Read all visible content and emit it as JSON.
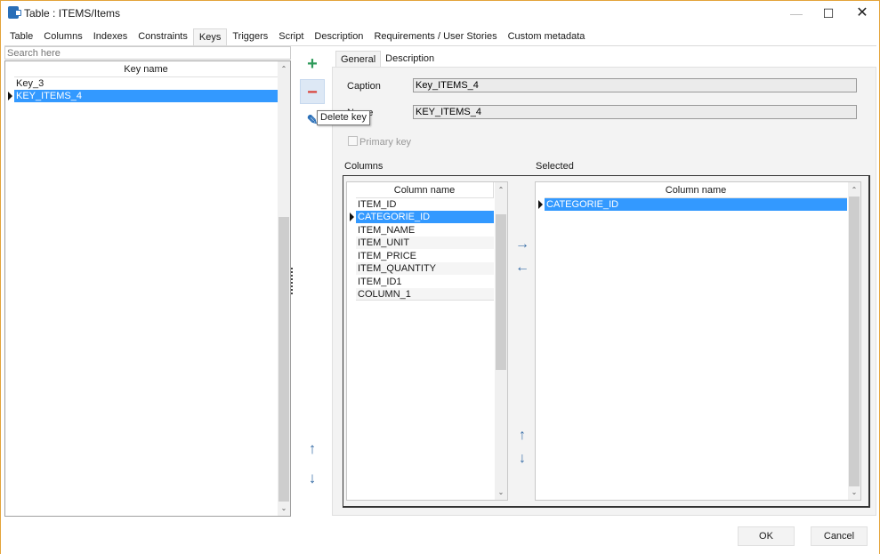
{
  "window": {
    "title": "Table : ITEMS/Items",
    "controls": {
      "minimize": "—",
      "maximize": "☐",
      "close": "✕"
    }
  },
  "tabs": [
    {
      "label": "Table",
      "active": false
    },
    {
      "label": "Columns",
      "active": false
    },
    {
      "label": "Indexes",
      "active": false
    },
    {
      "label": "Constraints",
      "active": false
    },
    {
      "label": "Keys",
      "active": true
    },
    {
      "label": "Triggers",
      "active": false
    },
    {
      "label": "Script",
      "active": false
    },
    {
      "label": "Description",
      "active": false
    },
    {
      "label": "Requirements / User Stories",
      "active": false
    },
    {
      "label": "Custom metadata",
      "active": false
    }
  ],
  "keys_panel": {
    "search_placeholder": "Search here",
    "header": "Key name",
    "rows": [
      {
        "name": "Key_3",
        "selected": false
      },
      {
        "name": "KEY_ITEMS_4",
        "selected": true
      }
    ]
  },
  "toolbar": {
    "add_icon": "+",
    "delete_icon": "−",
    "edit_icon": "✎",
    "up_icon": "↑",
    "down_icon": "↓",
    "tooltip": "Delete key"
  },
  "detail": {
    "subtabs": [
      {
        "label": "General",
        "active": true
      },
      {
        "label": "Description",
        "active": false
      }
    ],
    "caption_label": "Caption",
    "caption_value": "Key_ITEMS_4",
    "name_label": "Name",
    "name_value": "KEY_ITEMS_4",
    "primary_key_label": "Primary key",
    "primary_key_checked": false,
    "columns_label": "Columns",
    "selected_label": "Selected",
    "columns_header": "Column name",
    "columns": [
      {
        "name": "ITEM_ID",
        "selected": false
      },
      {
        "name": "CATEGORIE_ID",
        "selected": true
      },
      {
        "name": "ITEM_NAME",
        "selected": false
      },
      {
        "name": "ITEM_UNIT",
        "selected": false
      },
      {
        "name": "ITEM_PRICE",
        "selected": false
      },
      {
        "name": "ITEM_QUANTITY",
        "selected": false
      },
      {
        "name": "ITEM_ID1",
        "selected": false
      },
      {
        "name": "COLUMN_1",
        "selected": false
      }
    ],
    "selected_header": "Column name",
    "selected_columns": [
      {
        "name": "CATEGORIE_ID",
        "selected": true
      }
    ],
    "add_arrow": "→",
    "remove_arrow": "←",
    "move_up": "↑",
    "move_down": "↓"
  },
  "footer": {
    "ok": "OK",
    "cancel": "Cancel"
  },
  "colors": {
    "selection": "#3399ff",
    "accent_border": "#e3a33a",
    "add_green": "#2e9a5a",
    "delete_red": "#d9423a",
    "arrow_blue": "#3a6fa8"
  }
}
